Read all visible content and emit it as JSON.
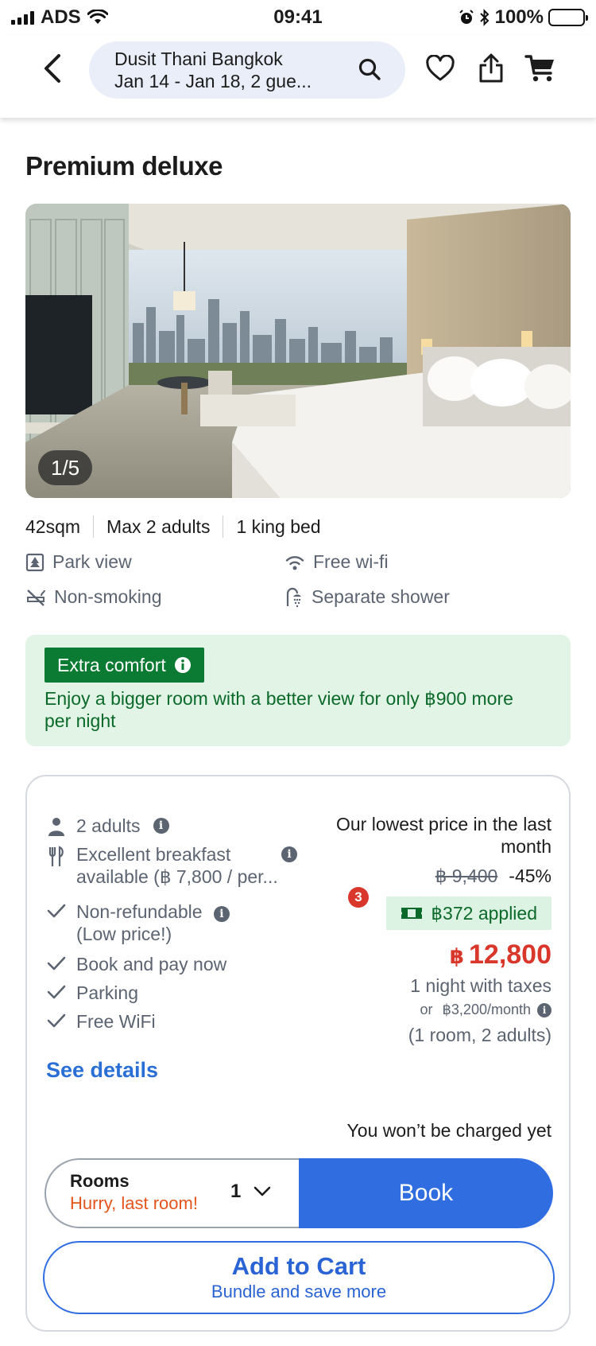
{
  "status_bar": {
    "carrier": "ADS",
    "time": "09:41",
    "battery": "100%"
  },
  "header": {
    "hotel_name": "Dusit Thani Bangkok",
    "dates_guests": "Jan 14 - Jan 18, 2 gue...",
    "icons": [
      "back-chevron-icon",
      "search-icon",
      "heart-icon",
      "share-icon",
      "cart-icon"
    ]
  },
  "room": {
    "title": "Premium deluxe",
    "photo_counter": "1/5",
    "specs": [
      "42sqm",
      "Max 2 adults",
      "1 king bed"
    ],
    "amenities": [
      {
        "label": "Park view",
        "icon": "park-view-icon"
      },
      {
        "label": "Free wi-fi",
        "icon": "wifi-icon"
      },
      {
        "label": "Non-smoking",
        "icon": "no-smoking-icon"
      },
      {
        "label": "Separate shower",
        "icon": "shower-icon"
      }
    ]
  },
  "upsell": {
    "badge": "Extra comfort",
    "text": "Enjoy a bigger room with a better view for only ฿900 more per night",
    "color": "#0b7a32"
  },
  "offer": {
    "features": [
      {
        "label": "2 adults",
        "icon": "person-icon"
      },
      {
        "label": "Excellent breakfast available (฿ 7,800 / per...",
        "icon": "fork-knife-icon"
      },
      {
        "label": "Non-refundable",
        "sub": "(Low price!)",
        "icon": "check-icon"
      },
      {
        "label": "Book and pay now",
        "icon": "check-icon"
      },
      {
        "label": "Parking",
        "icon": "check-icon"
      },
      {
        "label": "Free WiFi",
        "icon": "check-icon"
      }
    ],
    "see_details": "See details",
    "lowest_price_note": "Our lowest price in the last month",
    "original_price": "฿ 9,400",
    "discount": "-45%",
    "coupon_count": "3",
    "coupon_applied": "฿372 applied",
    "currency_symbol": "฿",
    "price": "12,800",
    "price_note": "1 night with taxes",
    "monthly_or": "or",
    "monthly_price": "฿3,200/month",
    "occupancy": "(1 room, 2 adults)",
    "no_charge_note": "You won’t be charged yet",
    "rooms_label": "Rooms",
    "rooms_warning": "Hurry, last room!",
    "rooms_qty": "1",
    "book_label": "Book",
    "cart_label": "Add to Cart",
    "cart_sub": "Bundle and save more",
    "colors": {
      "accent": "#2f6de1",
      "price": "#d9372b",
      "warning": "#e4541d",
      "green": "#0b6a2a"
    }
  }
}
